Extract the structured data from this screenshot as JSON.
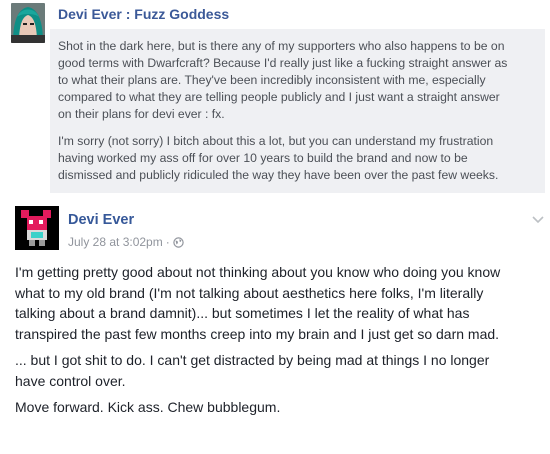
{
  "post1": {
    "author": "Devi Ever : Fuzz Goddess",
    "paragraphs": [
      [
        "Shot in the dark here, but is there any of my supporters who also happens to be on",
        "good terms with Dwarfcraft? Because I'd really just like a fucking straight answer as",
        "to what their plans are. They've been incredibly inconsistent with me, especially",
        "compared to what they are telling people publicly and I just want a straight answer",
        "on their plans for devi ever : fx."
      ],
      [
        "I'm sorry (not sorry) I bitch about this a lot, but you can understand my frustration",
        "having worked my ass off for over 10 years to build the brand and now to be",
        "dismissed and publicly ridiculed the way they have been over the past few weeks."
      ]
    ]
  },
  "post2": {
    "author": "Devi Ever",
    "timestamp": "July 28 at 3:02pm",
    "separator": "·",
    "privacy_icon": "globe-icon",
    "menu_icon": "chevron-down-icon",
    "paragraphs": [
      [
        "I'm getting pretty good about not thinking about you know who doing you know",
        "what to my old brand (I'm not talking about aesthetics here folks, I'm literally",
        "talking about a brand damnit)... but sometimes I let the reality of what has",
        "transpired the past few months creep into my brain and I just get so darn mad."
      ],
      [
        "... but I got shit to do. I can't get distracted by being mad at things I no longer",
        "have control over."
      ],
      [
        "Move forward. Kick ass. Chew bubblegum."
      ]
    ]
  },
  "colors": {
    "link": "#365899",
    "quote_bg": "#eff0f3",
    "meta": "#90949c"
  }
}
